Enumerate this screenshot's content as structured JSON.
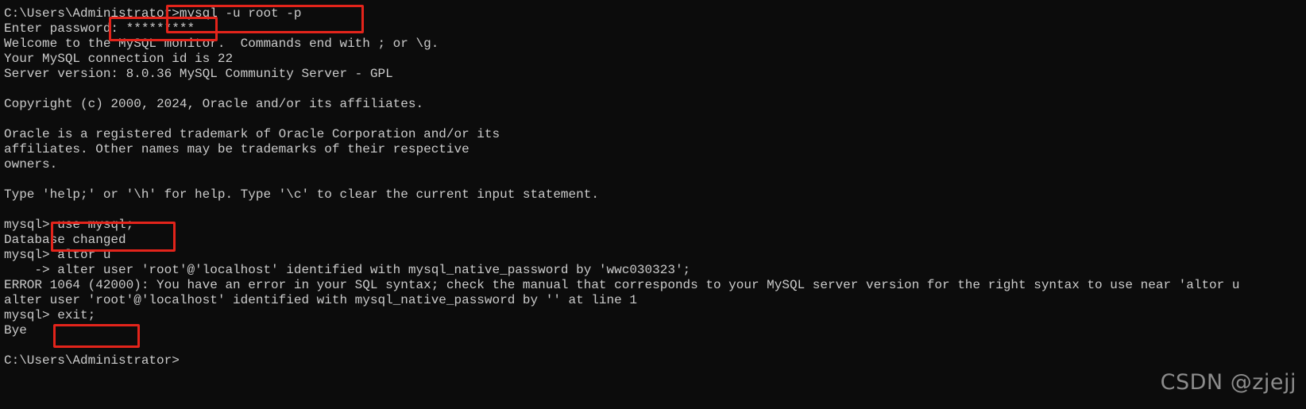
{
  "terminal": {
    "lines": [
      "C:\\Users\\Administrator>mysql -u root -p",
      "Enter password: *********",
      "Welcome to the MySQL monitor.  Commands end with ; or \\g.",
      "Your MySQL connection id is 22",
      "Server version: 8.0.36 MySQL Community Server - GPL",
      "",
      "Copyright (c) 2000, 2024, Oracle and/or its affiliates.",
      "",
      "Oracle is a registered trademark of Oracle Corporation and/or its",
      "affiliates. Other names may be trademarks of their respective",
      "owners.",
      "",
      "Type 'help;' or '\\h' for help. Type '\\c' to clear the current input statement.",
      "",
      "mysql> use mysql;",
      "Database changed",
      "mysql> altor u",
      "    -> alter user 'root'@'localhost' identified with mysql_native_password by 'wwc030323';",
      "ERROR 1064 (42000): You have an error in your SQL syntax; check the manual that corresponds to your MySQL server version for the right syntax to use near 'altor u",
      "alter user 'root'@'localhost' identified with mysql_native_password by '' at line 1",
      "mysql> exit;",
      "Bye",
      "",
      "C:\\Users\\Administrator>"
    ]
  },
  "watermark": {
    "text": "CSDN @zjejj"
  },
  "colors": {
    "background": "#0c0c0c",
    "text": "#cccccc",
    "highlight": "#e3241b"
  }
}
